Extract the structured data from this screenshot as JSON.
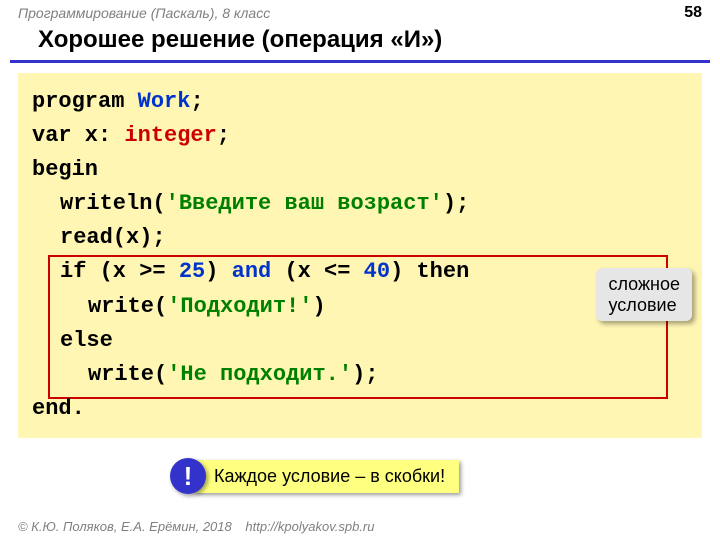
{
  "header": {
    "course": "Программирование (Паскаль), 8 класс",
    "page": "58"
  },
  "title": "Хорошее решение (операция «И»)",
  "code": {
    "l1_program": "program ",
    "l1_name": "Work",
    "l1_semi": ";",
    "l2_var": "var x: ",
    "l2_type": "integer",
    "l2_semi": ";",
    "l3": "begin",
    "l4_call": "writeln(",
    "l4_str": "'Введите ваш возраст'",
    "l4_end": ");",
    "l5": "read(x);",
    "l6_if": "if ",
    "l6_p1a": "(x >= ",
    "l6_n1": "25",
    "l6_p1b": ")",
    "l6_and": " and ",
    "l6_p2a": "(x <= ",
    "l6_n2": "40",
    "l6_p2b": ")",
    "l6_then": " then",
    "l7_call": "write(",
    "l7_str": "'Подходит!'",
    "l7_end": ")",
    "l8": "else",
    "l9_call": "write(",
    "l9_str": "'Не подходит.'",
    "l9_end": ");",
    "l10": "end."
  },
  "callout": {
    "line1": "сложное",
    "line2": "условие"
  },
  "note": {
    "badge": "!",
    "text": "Каждое условие – в скобки!"
  },
  "footer": {
    "copy": "© К.Ю. Поляков, Е.А. Ерёмин, 2018",
    "url": "http://kpolyakov.spb.ru"
  }
}
